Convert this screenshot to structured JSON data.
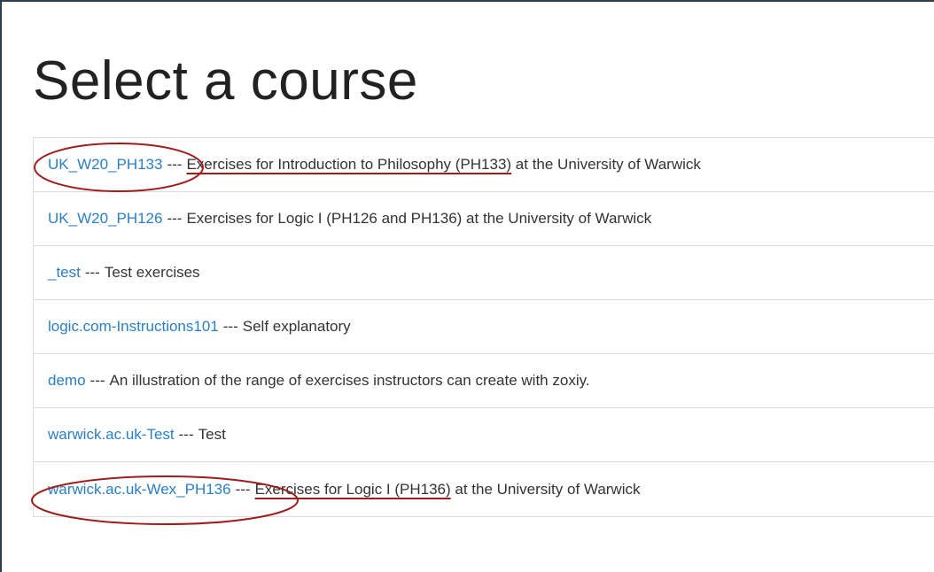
{
  "page": {
    "title": "Select a course"
  },
  "courses": [
    {
      "code": "UK_W20_PH133",
      "separator": "---",
      "description": "Exercises for Introduction to Philosophy (PH133)",
      "suffix": " at the University of Warwick"
    },
    {
      "code": "UK_W20_PH126",
      "separator": "---",
      "description": "Exercises for Logic I (PH126 and PH136) at the University of Warwick",
      "suffix": ""
    },
    {
      "code": "_test",
      "separator": "---",
      "description": "Test exercises",
      "suffix": ""
    },
    {
      "code": "logic.com-Instructions101",
      "separator": "---",
      "description": "Self explanatory",
      "suffix": ""
    },
    {
      "code": "demo",
      "separator": "---",
      "description": "An illustration of the range of exercises instructors can create with zoxiy.",
      "suffix": ""
    },
    {
      "code": "warwick.ac.uk-Test",
      "separator": "---",
      "description": "Test",
      "suffix": ""
    },
    {
      "code": "warwick.ac.uk-Wex_PH136",
      "separator": "---",
      "description": "Exercises for Logic I (PH136)",
      "suffix": " at the University of Warwick"
    }
  ],
  "colors": {
    "link": "#2a7fc4",
    "text": "#333333",
    "annotation": "#a01d1d",
    "frame": "#2f3f52"
  }
}
